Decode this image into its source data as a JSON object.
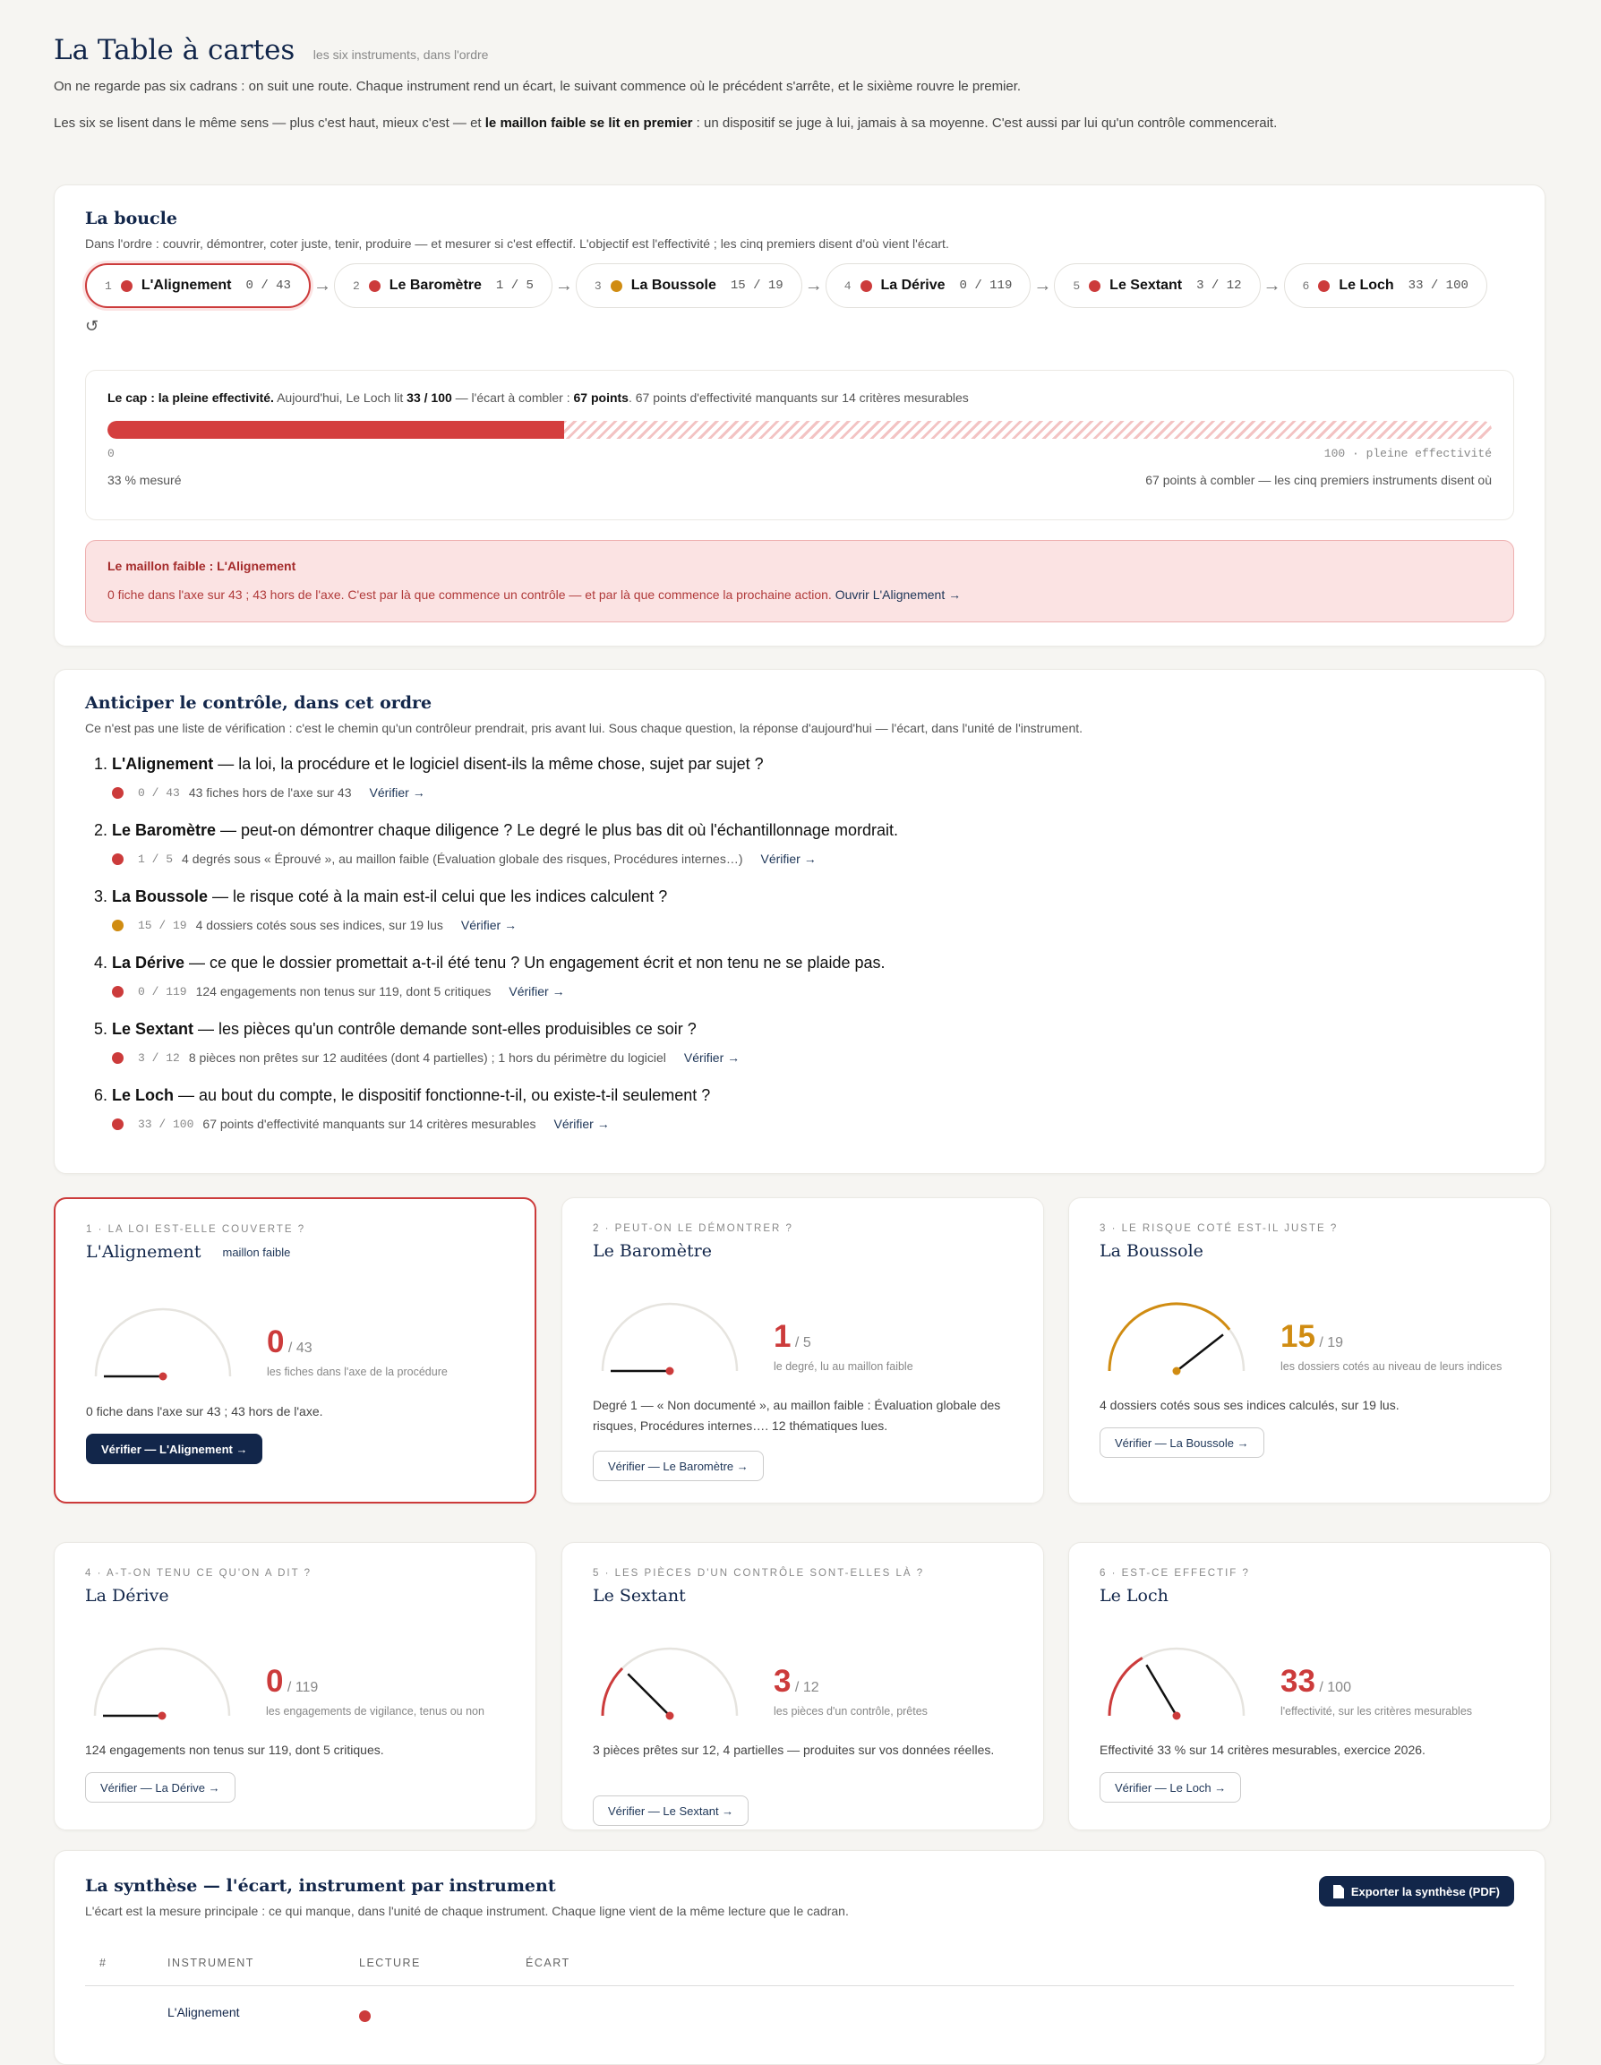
{
  "header": {
    "title": "La Table à cartes",
    "subtitle": "les six instruments, dans l'ordre",
    "intro1": "On ne regarde pas six cadrans : on suit une route. Chaque instrument rend un écart, le suivant commence où le précédent s'arrête, et le sixième rouvre le premier.",
    "intro2a": "Les six se lisent dans le même sens — plus c'est haut, mieux c'est — et ",
    "intro2b": "le maillon faible se lit en premier",
    "intro2c": " : un dispositif se juge à lui, jamais à sa moyenne. C'est aussi par lui qu'un contrôle commencerait."
  },
  "loop": {
    "title": "La boucle",
    "desc": "Dans l'ordre : couvrir, démontrer, coter juste, tenir, produire — et mesurer si c'est effectif. L'objectif est l'effectivité ; les cinq premiers disent d'où vient l'écart.",
    "reset_icon": "↺",
    "chips": [
      {
        "n": "1",
        "name": "L'Alignement",
        "score": "0 / 43",
        "status": "red"
      },
      {
        "n": "2",
        "name": "Le Baromètre",
        "score": "1 / 5",
        "status": "red"
      },
      {
        "n": "3",
        "name": "La Boussole",
        "score": "15 / 19",
        "status": "amber"
      },
      {
        "n": "4",
        "name": "La Dérive",
        "score": "0 / 119",
        "status": "red"
      },
      {
        "n": "5",
        "name": "Le Sextant",
        "score": "3 / 12",
        "status": "red"
      },
      {
        "n": "6",
        "name": "Le Loch",
        "score": "33 / 100",
        "status": "red"
      }
    ],
    "cap": {
      "lead": "Le cap : la pleine effectivité.",
      "t1": " Aujourd'hui, Le Loch lit ",
      "score": "33 / 100",
      "t2": " — l'écart à combler : ",
      "gap": "67 points",
      "t3": ". 67 points d'effectivité manquants sur 14 critères mesurables",
      "progress": 0.33,
      "tick_min": "0",
      "tick_max": "100 · pleine effectivité",
      "foot_left": "33 % mesuré",
      "foot_right": "67 points à combler — les cinq premiers instruments disent où"
    },
    "weak": {
      "title": "Le maillon faible : L'Alignement",
      "desc": "0 fiche dans l'axe sur 43 ; 43 hors de l'axe. C'est par là que commence un contrôle — et par là que commence la prochaine action. ",
      "link": "Ouvrir L'Alignement →"
    }
  },
  "control": {
    "title": "Anticiper le contrôle, dans cet ordre",
    "desc": "Ce n'est pas une liste de vérification : c'est le chemin qu'un contrôleur prendrait, pris avant lui. Sous chaque question, la réponse d'aujourd'hui — l'écart, dans l'unité de l'instrument.",
    "items": [
      {
        "name": "L'Alignement",
        "q": " — la loi, la procédure et le logiciel disent-ils la même chose, sujet par sujet ?",
        "score": "0 / 43",
        "note": "43 fiches hors de l'axe sur 43",
        "link": "Vérifier →",
        "status": "red"
      },
      {
        "name": "Le Baromètre",
        "q": " — peut-on démontrer chaque diligence ? Le degré le plus bas dit où l'échantillonnage mordrait.",
        "score": "1 / 5",
        "note": "4 degrés sous « Éprouvé », au maillon faible (Évaluation globale des risques, Procédures internes…)",
        "link": "Vérifier →",
        "status": "red"
      },
      {
        "name": "La Boussole",
        "q": " — le risque coté à la main est-il celui que les indices calculent ?",
        "score": "15 / 19",
        "note": "4 dossiers cotés sous ses indices, sur 19 lus",
        "link": "Vérifier →",
        "status": "amber"
      },
      {
        "name": "La Dérive",
        "q": " — ce que le dossier promettait a-t-il été tenu ? Un engagement écrit et non tenu ne se plaide pas.",
        "score": "0 / 119",
        "note": "124 engagements non tenus sur 119, dont 5 critiques",
        "link": "Vérifier →",
        "status": "red"
      },
      {
        "name": "Le Sextant",
        "q": " — les pièces qu'un contrôle demande sont-elles produisibles ce soir ?",
        "score": "3 / 12",
        "note": "8 pièces non prêtes sur 12 auditées (dont 4 partielles) ; 1 hors du périmètre du logiciel",
        "link": "Vérifier →",
        "status": "red"
      },
      {
        "name": "Le Loch",
        "q": " — au bout du compte, le dispositif fonctionne-t-il, ou existe-t-il seulement ?",
        "score": "33 / 100",
        "note": "67 points d'effectivité manquants sur 14 critères mesurables",
        "link": "Vérifier →",
        "status": "red"
      }
    ]
  },
  "instruments": [
    {
      "eyebrow": "1 · LA LOI EST-ELLE COUVERTE ?",
      "name": "L'Alignement",
      "tag": "maillon faible",
      "value": "0",
      "den": "/ 43",
      "caption": "les fiches dans l'axe de la procédure",
      "desc": "0 fiche dans l'axe sur 43 ; 43 hors de l'axe.",
      "button": "Vérifier — L'Alignement →",
      "ratio": 0,
      "status": "red",
      "weak": true
    },
    {
      "eyebrow": "2 · PEUT-ON LE DÉMONTRER ?",
      "name": "Le Baromètre",
      "tag": "",
      "value": "1",
      "den": "/ 5",
      "caption": "le degré, lu au maillon faible",
      "desc": "Degré 1 — « Non documenté », au maillon faible : Évaluation globale des risques, Procédures internes…. 12 thématiques lues.",
      "button": "Vérifier — Le Baromètre →",
      "ratio": 0,
      "status": "red",
      "weak": false
    },
    {
      "eyebrow": "3 · LE RISQUE COTÉ EST-IL JUSTE ?",
      "name": "La Boussole",
      "tag": "",
      "value": "15",
      "den": "/ 19",
      "caption": "les dossiers cotés au niveau de leurs indices",
      "desc": "4 dossiers cotés sous ses indices calculés, sur 19 lus.",
      "button": "Vérifier — La Boussole →",
      "ratio": 0.789,
      "status": "amber",
      "weak": false
    },
    {
      "eyebrow": "4 · A-T-ON TENU CE QU'ON A DIT ?",
      "name": "La Dérive",
      "tag": "",
      "value": "0",
      "den": "/ 119",
      "caption": "les engagements de vigilance, tenus ou non",
      "desc": "124 engagements non tenus sur 119, dont 5 critiques.",
      "button": "Vérifier — La Dérive →",
      "ratio": 0,
      "status": "red",
      "weak": false
    },
    {
      "eyebrow": "5 · LES PIÈCES D'UN CONTRÔLE SONT-ELLES LÀ ?",
      "name": "Le Sextant",
      "tag": "",
      "value": "3",
      "den": "/ 12",
      "caption": "les pièces d'un contrôle, prêtes",
      "desc": "3 pièces prêtes sur 12, 4 partielles — produites sur vos données réelles.",
      "button": "Vérifier — Le Sextant →",
      "ratio": 0.25,
      "status": "red",
      "weak": false
    },
    {
      "eyebrow": "6 · EST-CE EFFECTIF ?",
      "name": "Le Loch",
      "tag": "",
      "value": "33",
      "den": "/ 100",
      "caption": "l'effectivité, sur les critères mesurables",
      "desc": "Effectivité 33 % sur 14 critères mesurables, exercice 2026.",
      "button": "Vérifier — Le Loch →",
      "ratio": 0.33,
      "status": "red",
      "weak": false
    }
  ],
  "synthesis": {
    "title": "La synthèse — l'écart, instrument par instrument",
    "desc": "L'écart est la mesure principale : ce qui manque, dans l'unité de chaque instrument. Chaque ligne vient de la même lecture que le cadran.",
    "export": "Exporter la synthèse (PDF)",
    "export_icon": "document-icon",
    "columns": [
      "#",
      "INSTRUMENT",
      "LECTURE",
      "ÉCART"
    ],
    "first_row_name": "L'Alignement"
  },
  "colors": {
    "red": "#cc3b3b",
    "amber": "#d08c12",
    "navy": "#12264a"
  }
}
